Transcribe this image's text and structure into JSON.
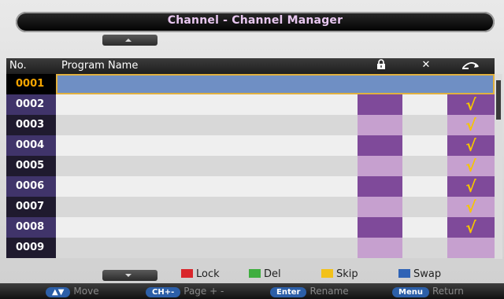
{
  "title": "Channel - Channel Manager",
  "header": {
    "no": "No.",
    "program_name": "Program Name",
    "lock_icon": "lock-icon",
    "del_icon": "✕",
    "swap_icon": "swap-icon"
  },
  "rows": [
    {
      "no": "0001",
      "swap": ""
    },
    {
      "no": "0002",
      "swap": "√"
    },
    {
      "no": "0003",
      "swap": "√"
    },
    {
      "no": "0004",
      "swap": "√"
    },
    {
      "no": "0005",
      "swap": "√"
    },
    {
      "no": "0006",
      "swap": "√"
    },
    {
      "no": "0007",
      "swap": "√"
    },
    {
      "no": "0008",
      "swap": "√"
    },
    {
      "no": "0009",
      "swap": ""
    }
  ],
  "legend": {
    "lock": "Lock",
    "del": "Del",
    "skip": "Skip",
    "swap": "Swap",
    "colors": {
      "lock": "#d9262b",
      "del": "#3fae3f",
      "skip": "#f2c11a",
      "swap": "#2f63b6"
    }
  },
  "help": {
    "move_key": "▲▼",
    "move": "Move",
    "page_key": "CH+-",
    "page": "Page + -",
    "rename_key": "Enter",
    "rename": "Rename",
    "return_key": "Menu",
    "return": "Return"
  }
}
